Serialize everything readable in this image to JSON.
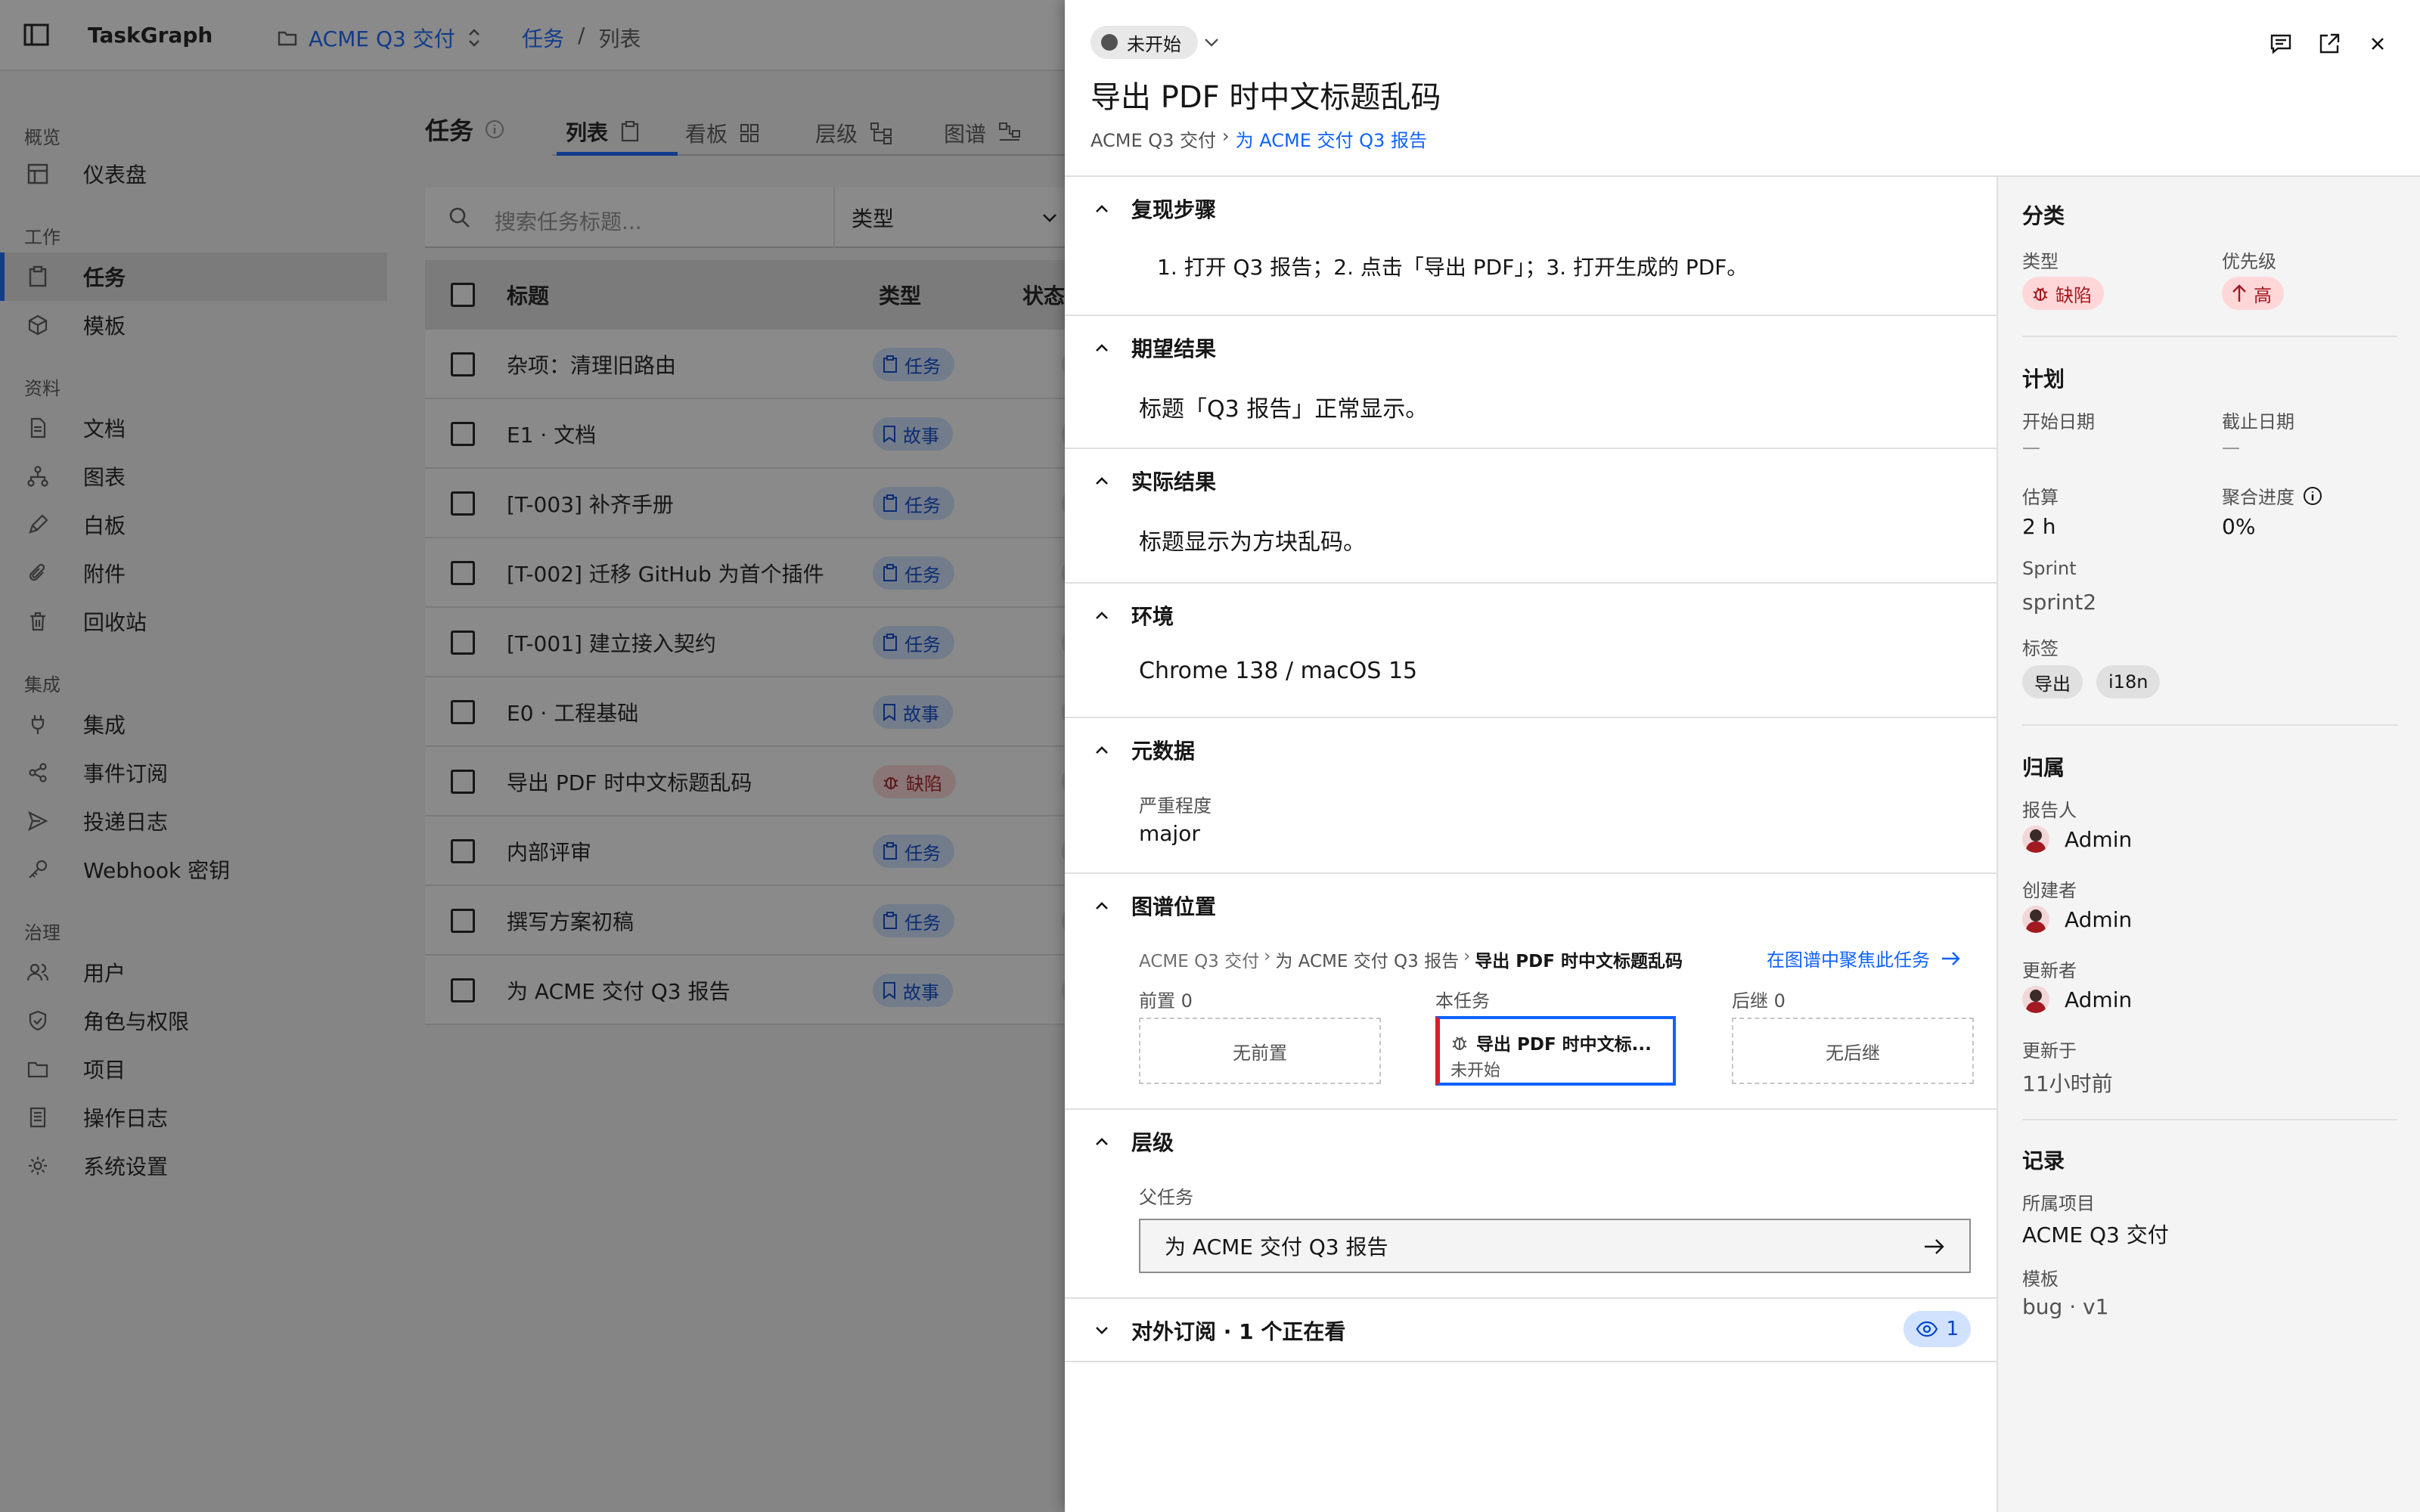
{
  "app": {
    "brand": "TaskGraph",
    "project": "ACME Q3 交付"
  },
  "breadcrumb": {
    "section": "任务",
    "sep": "/",
    "current": "列表"
  },
  "sidebar": {
    "sections": [
      "概览",
      "工作",
      "资料",
      "集成",
      "治理"
    ],
    "items": [
      {
        "label": "仪表盘",
        "icon": "dashboard-icon"
      },
      {
        "label": "任务",
        "icon": "clipboard-icon",
        "active": true
      },
      {
        "label": "模板",
        "icon": "cube-icon"
      },
      {
        "label": "文档",
        "icon": "document-icon"
      },
      {
        "label": "图表",
        "icon": "flow-icon"
      },
      {
        "label": "白板",
        "icon": "pen-icon"
      },
      {
        "label": "附件",
        "icon": "paperclip-icon"
      },
      {
        "label": "回收站",
        "icon": "trash-icon"
      },
      {
        "label": "集成",
        "icon": "plug-icon"
      },
      {
        "label": "事件订阅",
        "icon": "share-icon"
      },
      {
        "label": "投递日志",
        "icon": "send-icon"
      },
      {
        "label": "Webhook 密钥",
        "icon": "key-icon"
      },
      {
        "label": "用户",
        "icon": "users-icon"
      },
      {
        "label": "角色与权限",
        "icon": "shield-icon"
      },
      {
        "label": "项目",
        "icon": "folder-icon"
      },
      {
        "label": "操作日志",
        "icon": "log-icon"
      },
      {
        "label": "系统设置",
        "icon": "gear-icon"
      }
    ]
  },
  "main": {
    "title": "任务",
    "tabs": [
      "列表",
      "看板",
      "层级",
      "图谱"
    ],
    "search_placeholder": "搜索任务标题...",
    "type_filter": "类型",
    "columns": [
      "标题",
      "类型",
      "状态"
    ],
    "rows": [
      {
        "title": "杂项：清理旧路由",
        "type": "任务",
        "kind": "task"
      },
      {
        "title": "E1 · 文档",
        "type": "故事",
        "kind": "story"
      },
      {
        "title": "[T-003] 补齐手册",
        "type": "任务",
        "kind": "task"
      },
      {
        "title": "[T-002] 迁移 GitHub 为首个插件",
        "type": "任务",
        "kind": "task"
      },
      {
        "title": "[T-001] 建立接入契约",
        "type": "任务",
        "kind": "task"
      },
      {
        "title": "E0 · 工程基础",
        "type": "故事",
        "kind": "story"
      },
      {
        "title": "导出 PDF 时中文标题乱码",
        "type": "缺陷",
        "kind": "bug"
      },
      {
        "title": "内部评审",
        "type": "任务",
        "kind": "task"
      },
      {
        "title": "撰写方案初稿",
        "type": "任务",
        "kind": "task"
      },
      {
        "title": "为 ACME 交付 Q3 报告",
        "type": "故事",
        "kind": "story"
      }
    ]
  },
  "drawer": {
    "status": "未开始",
    "title": "导出 PDF 时中文标题乱码",
    "crumb_project": "ACME Q3 交付",
    "crumb_sep": "›",
    "crumb_parent": "为 ACME 交付 Q3 报告",
    "sections": {
      "repro": {
        "title": "复现步骤",
        "body": "1. 打开 Q3 报告；2. 点击「导出 PDF」；3. 打开生成的 PDF。"
      },
      "expected": {
        "title": "期望结果",
        "body": "标题「Q3 报告」正常显示。"
      },
      "actual": {
        "title": "实际结果",
        "body": "标题显示为方块乱码。"
      },
      "env": {
        "title": "环境",
        "body": "Chrome 138 / macOS 15"
      },
      "meta": {
        "title": "元数据",
        "severity_label": "严重程度",
        "severity": "major"
      },
      "graph": {
        "title": "图谱位置",
        "crumb": [
          "ACME Q3 交付",
          "为 ACME 交付 Q3 报告",
          "导出 PDF 时中文标题乱码"
        ],
        "focus_link": "在图谱中聚焦此任务",
        "pred_label": "前置 0",
        "self_label": "本任务",
        "succ_label": "后继 0",
        "no_pred": "无前置",
        "no_succ": "无后继",
        "node_title": "导出 PDF 时中文标...",
        "node_status": "未开始"
      },
      "hierarchy": {
        "title": "层级",
        "parent_label": "父任务",
        "parent": "为 ACME 交付 Q3 报告"
      },
      "subscribe": {
        "title": "对外订阅 · 1 个正在看",
        "watchers": "1"
      }
    }
  },
  "panel": {
    "classify": {
      "title": "分类",
      "type_label": "类型",
      "type": "缺陷",
      "priority_label": "优先级",
      "priority": "高"
    },
    "plan": {
      "title": "计划",
      "start_label": "开始日期",
      "start": "—",
      "due_label": "截止日期",
      "due": "—",
      "estimate_label": "估算",
      "estimate": "2 h",
      "progress_label": "聚合进度",
      "progress": "0%",
      "sprint_label": "Sprint",
      "sprint": "sprint2",
      "tags_label": "标签",
      "tags": [
        "导出",
        "i18n"
      ]
    },
    "owner": {
      "title": "归属",
      "reporter_label": "报告人",
      "reporter": "Admin",
      "creator_label": "创建者",
      "creator": "Admin",
      "updater_label": "更新者",
      "updater": "Admin",
      "updated_label": "更新于",
      "updated": "11小时前"
    },
    "record": {
      "title": "记录",
      "project_label": "所属项目",
      "project": "ACME Q3 交付",
      "template_label": "模板",
      "template": "bug · v1"
    }
  },
  "colors": {
    "accent": "#0f62fe",
    "danger": "#da1e28",
    "overlay": "rgba(22,22,22,0.5)"
  }
}
